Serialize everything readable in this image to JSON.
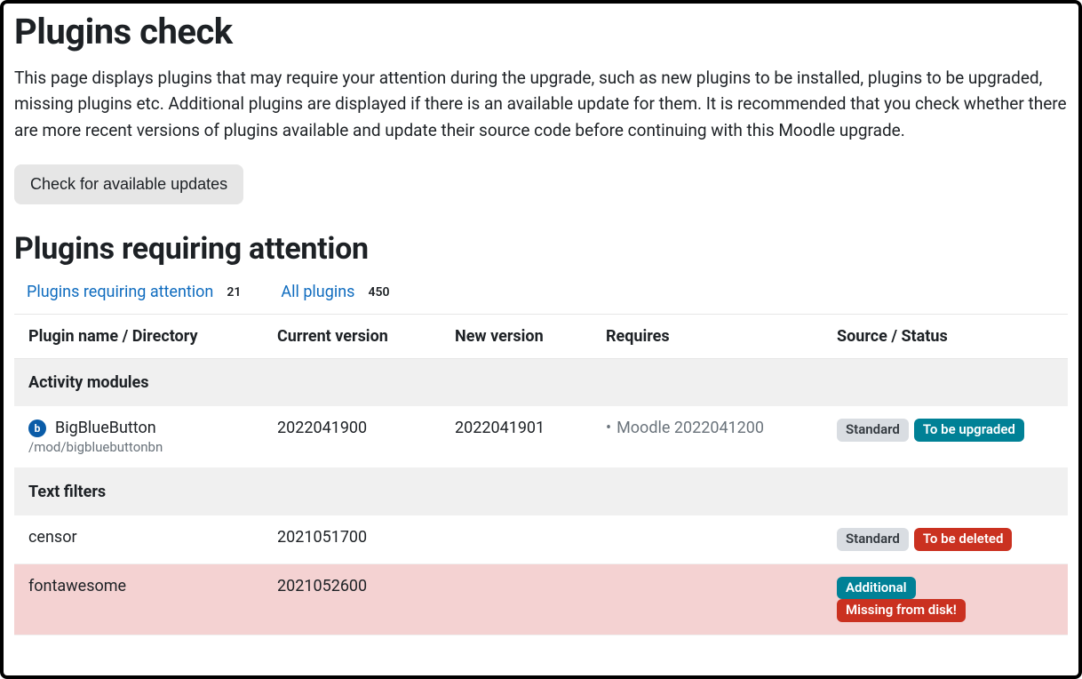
{
  "page": {
    "title": "Plugins check",
    "intro": "This page displays plugins that may require your attention during the upgrade, such as new plugins to be installed, plugins to be upgraded, missing plugins etc. Additional plugins are displayed if there is an available update for them. It is recommended that you check whether there are more recent versions of plugins available and update their source code before continuing with this Moodle upgrade.",
    "check_updates_label": "Check for available updates",
    "section_title": "Plugins requiring attention"
  },
  "filters": {
    "attention": {
      "label": "Plugins requiring attention",
      "count": "21"
    },
    "all": {
      "label": "All plugins",
      "count": "450"
    }
  },
  "table": {
    "headers": {
      "name": "Plugin name / Directory",
      "current": "Current version",
      "newv": "New version",
      "req": "Requires",
      "status": "Source / Status"
    },
    "sections": [
      {
        "title": "Activity modules",
        "rows": [
          {
            "icon_letter": "b",
            "name": "BigBlueButton",
            "dir": "/mod/bigbluebuttonbn",
            "current": "2022041900",
            "newv": "2022041901",
            "requires": "Moodle 2022041200",
            "source_pill": "Standard",
            "status_pill": "To be upgraded",
            "status_kind": "upgrade",
            "row_class": ""
          }
        ]
      },
      {
        "title": "Text filters",
        "rows": [
          {
            "icon_letter": "",
            "name": "censor",
            "dir": "",
            "current": "2021051700",
            "newv": "",
            "requires": "",
            "source_pill": "Standard",
            "status_pill": "To be deleted",
            "status_kind": "delete",
            "row_class": ""
          },
          {
            "icon_letter": "",
            "name": "fontawesome",
            "dir": "",
            "current": "2021052600",
            "newv": "",
            "requires": "",
            "source_pill": "Additional",
            "status_pill": "Missing from disk!",
            "status_kind": "missing",
            "row_class": "row-missing"
          }
        ]
      }
    ]
  }
}
